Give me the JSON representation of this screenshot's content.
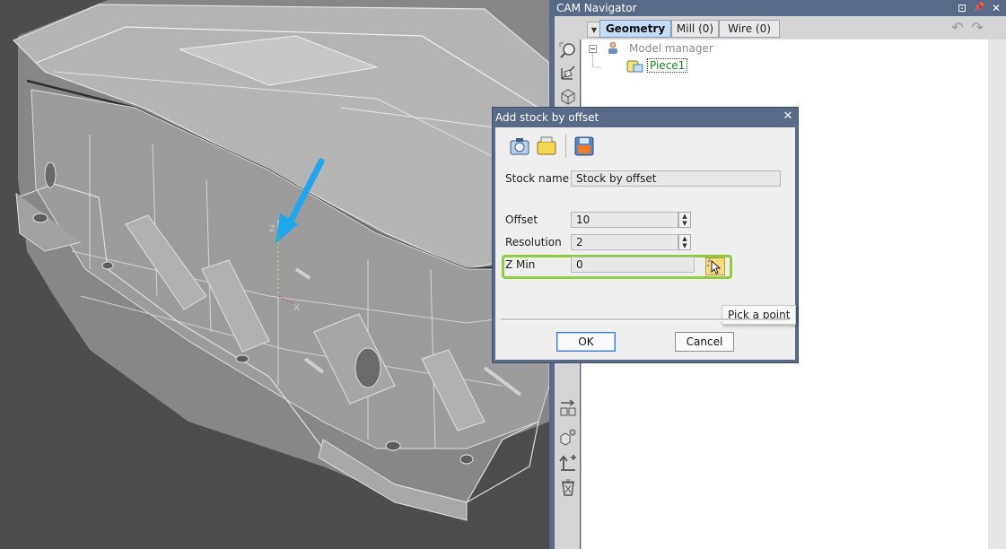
{
  "navigator": {
    "title": "CAM Navigator",
    "dock_icon": "⊡",
    "pin_icon": "📌",
    "close_icon": "✕",
    "tabs": [
      {
        "label": "Geometry",
        "active": true
      },
      {
        "label": "Mill (0)",
        "active": false
      },
      {
        "label": "Wire (0)",
        "active": false
      }
    ],
    "tree": {
      "root_label": "Model manager",
      "child_label": "Piece1",
      "child_color": "#1a8a1a"
    },
    "toolbar_icons": [
      "zoom-icon",
      "axis-icon",
      "solid-cube-icon",
      "arrow-grid-icon",
      "cube-group-icon",
      "upload-icon",
      "trash-icon"
    ]
  },
  "dialog": {
    "title": "Add stock by offset",
    "close_icon": "✕",
    "stock_name": {
      "label": "Stock name",
      "value": "Stock by offset"
    },
    "offset": {
      "label": "Offset",
      "value": "10"
    },
    "resolution": {
      "label": "Resolution",
      "value": "2"
    },
    "z_min": {
      "label": "Z Min",
      "value": "0"
    },
    "pick_tooltip": "Pick a point",
    "ok_label": "OK",
    "cancel_label": "Cancel",
    "highlight_color": "#8fcd3b"
  },
  "viewport": {
    "axis_labels": {
      "x": "X",
      "z": "Z"
    },
    "arrow_color": "#1ea7ec"
  }
}
